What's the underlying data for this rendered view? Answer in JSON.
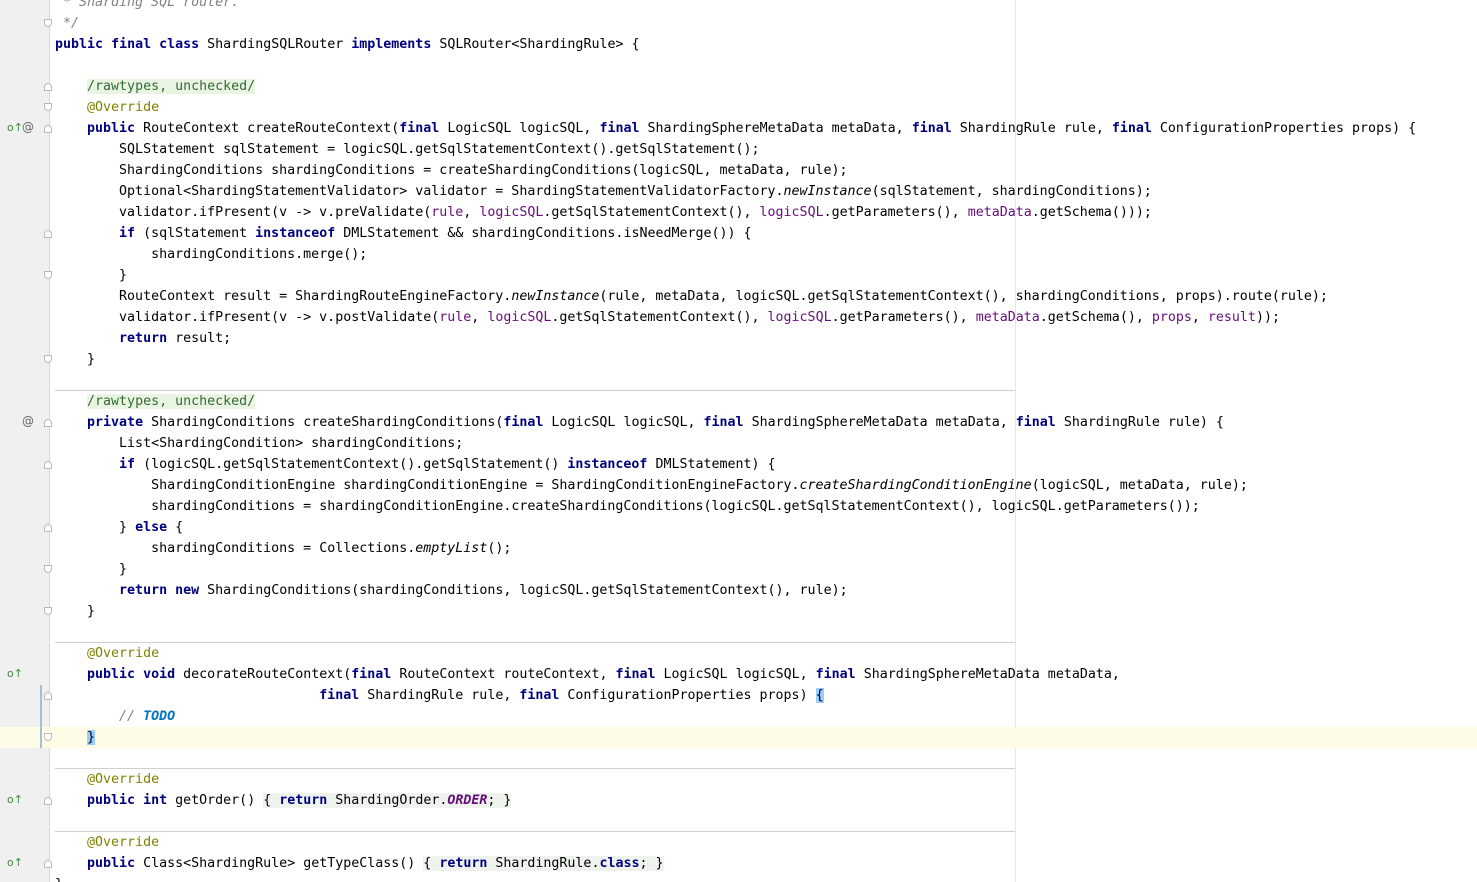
{
  "editor": {
    "language": "java",
    "colors": {
      "keyword": "#000080",
      "annotation": "#808000",
      "suppress_comment": "#356b35",
      "field": "#660e7a",
      "comment": "#808080",
      "todo": "#0073bf",
      "gutter": "#f0f0f0",
      "current_line": "#fefbe6"
    },
    "text": {
      "l0_comment": " * Sharding SQL router.",
      "l1_comment": " */",
      "l2_public": "public",
      "l2_final": "final",
      "l2_class": "class",
      "l2_name": "ShardingSQLRouter",
      "l2_implements": "implements",
      "l2_rest": "SQLRouter<ShardingRule> {",
      "suppress": "/rawtypes, unchecked/",
      "override": "@Override",
      "l6_public": "public",
      "l6_a": "RouteContext createRouteContext(",
      "l6_final": "final",
      "l6_b": "LogicSQL logicSQL,",
      "l6_c": "ShardingSphereMetaData metaData,",
      "l6_d": "ShardingRule rule,",
      "l6_e": "ConfigurationProperties props) {",
      "l7": "SQLStatement sqlStatement = logicSQL.getSqlStatementContext().getSqlStatement();",
      "l8": "ShardingConditions shardingConditions = createShardingConditions(logicSQL, metaData, rule);",
      "l9_a": "Optional<ShardingStatementValidator> validator = ShardingStatementValidatorFactory.",
      "l9_it": "newInstance",
      "l9_b": "(sqlStatement, shardingConditions);",
      "l10_a": "validator.ifPresent(v -> v.preValidate(",
      "l10_b": "getSqlStatementContext(),",
      "l10_c": "getParameters(),",
      "l10_d": "getSchema()));",
      "w_rule": "rule",
      "w_logicsql": "logicSQL",
      "w_metadata": "metaData",
      "w_props": "props",
      "w_result": "result",
      "l11_if": "if",
      "l11_a": "(sqlStatement",
      "l11_instanceof": "instanceof",
      "l11_b": "DMLStatement && shardingConditions.isNeedMerge()) {",
      "l12": "shardingConditions.merge();",
      "close_brace": "}",
      "l14_a": "RouteContext result = ShardingRouteEngineFactory.",
      "l14_it": "newInstance",
      "l14_b": "(rule, metaData, logicSQL.getSqlStatementContext(), shardingConditions, props).route(rule);",
      "l15_a": "validator.ifPresent(v -> v.postValidate(",
      "l15_b": "getSqlStatementContext(),",
      "l15_c": "getParameters(),",
      "l15_d": "getSchema(),",
      "l15_e": "));",
      "kw_return": "return",
      "l16_rest": "result;",
      "l20_private": "private",
      "l20_a": "ShardingConditions createShardingConditions(",
      "l20_b": "LogicSQL logicSQL,",
      "l20_c": "ShardingSphereMetaData metaData,",
      "l20_d": "ShardingRule rule) {",
      "l21": "List<ShardingCondition> shardingConditions;",
      "l22_if": "if",
      "l22_a": "(logicSQL.getSqlStatementContext().getSqlStatement()",
      "l22_instanceof": "instanceof",
      "l22_b": "DMLStatement) {",
      "l23_a": "ShardingConditionEngine shardingConditionEngine = ShardingConditionEngineFactory.",
      "l23_it": "createShardingConditionEngine",
      "l23_b": "(logicSQL, metaData, rule);",
      "l24": "shardingConditions = shardingConditionEngine.createShardingConditions(logicSQL.getSqlStatementContext(), logicSQL.getParameters());",
      "l25_a": "}",
      "l25_else": "else",
      "l25_b": "{",
      "l26_a": "shardingConditions = Collections.",
      "l26_it": "emptyList",
      "l26_b": "();",
      "l28_new": "new",
      "l28_rest": "ShardingConditions(shardingConditions, logicSQL.getSqlStatementContext(), rule);",
      "l32_public": "public",
      "l32_void": "void",
      "l32_a": "decorateRouteContext(",
      "l32_b": "RouteContext routeContext,",
      "l32_c": "LogicSQL logicSQL,",
      "l32_d": "ShardingSphereMetaData metaData,",
      "l33_final": "final",
      "l33_a": "ShardingRule rule,",
      "l33_b": "ConfigurationProperties props)",
      "open_brace": "{",
      "l34_slashes": "// ",
      "l34_todo": "TODO",
      "l38_public": "public",
      "l38_int": "int",
      "l38_a": "getOrder()",
      "l38_b": "ShardingOrder.",
      "l38_field": "ORDER",
      "l38_c": ";",
      "l41_public": "public",
      "l41_a": "Class<ShardingRule> getTypeClass()",
      "l41_b": "ShardingRule.",
      "l41_class": "class",
      "l41_c": ";",
      "fb_open": "{ ",
      "fb_close": " }",
      "mark_at": "@",
      "mark_impl": "o↑"
    }
  }
}
